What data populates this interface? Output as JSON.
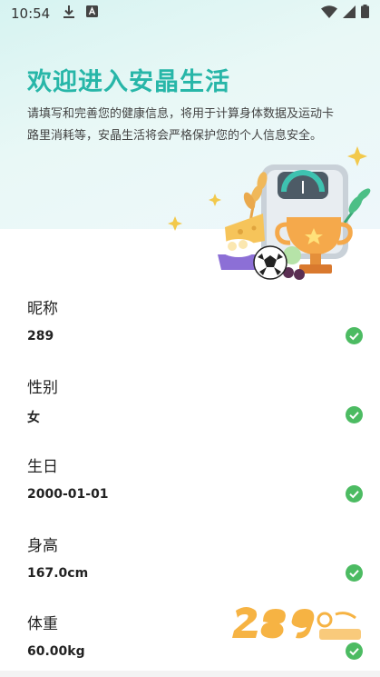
{
  "status_bar": {
    "time": "10:54",
    "left_icons": [
      "download-icon",
      "a-box-icon"
    ],
    "right_icons": [
      "wifi-icon",
      "signal-icon",
      "battery-icon"
    ]
  },
  "welcome": {
    "title": "欢迎进入安晶生活",
    "description_line1": "请填写和完善您的健康信息，将用于计算身体数据及运动卡",
    "description_line2": "路里消耗等，安晶生活将会严格保护您的个人信息安全。"
  },
  "form": {
    "nickname": {
      "label": "昵称",
      "value": "289"
    },
    "gender": {
      "label": "性别",
      "value": "女"
    },
    "birthday": {
      "label": "生日",
      "value": "2000-01-01"
    },
    "height": {
      "label": "身高",
      "value": "167.0cm"
    },
    "weight": {
      "label": "体重",
      "value": "60.00kg"
    }
  },
  "colors": {
    "accent": "#27b6a8",
    "check": "#4cbb62"
  }
}
